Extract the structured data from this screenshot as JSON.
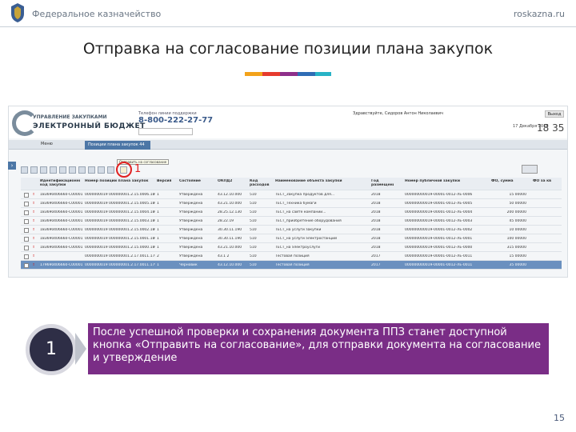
{
  "header": {
    "org": "Федеральное казначейство",
    "site": "roskazna.ru"
  },
  "slide": {
    "title": "Отправка на согласование позиции плана закупок",
    "page_number": "15"
  },
  "colors": {
    "bar": [
      "#f3a21a",
      "#e63b2e",
      "#8e2f8a",
      "#2f6db5",
      "#28b3c6"
    ],
    "note_bg": "#7a2d86"
  },
  "screenshot": {
    "logo_line1": "УПРАВЛЕНИЕ ЗАКУПКАМИ",
    "logo_line2": "ЭЛЕКТРОННЫЙ БЮДЖЕТ",
    "phone_label": "Телефон линии поддержки",
    "phone": "8-800-222-27-77",
    "user": "Здравствуйте, Сидоров Антон Николаевич",
    "exit": "Выход",
    "date": "17 Декабря 2018",
    "time": "18 35",
    "menu_tab": "Меню",
    "active_tab": "Позиции плана закупок 44",
    "tooltip": "Отправить на согласование",
    "marker_label": "1",
    "columns": [
      "Идентификационный код закупки",
      "Номер позиции плана закупок",
      "Версия",
      "Состояние",
      "ОКПД2",
      "Код расходов",
      "Наименование объекта закупки",
      "Год размещения",
      "Номер публичной закупки",
      "ФО, сумма",
      "ФО за кв"
    ],
    "rows": [
      [
        "183690406660-C00001...",
        "0000000019 000000001.2.15.0006.180",
        "1",
        "Утверждена",
        "43.12.10.000",
        "510",
        "ТЕСТ_Закупка продуктов для...",
        "2018",
        "000000000019-00001-0012-ЛЕ-0006",
        "15 00000"
      ],
      [
        "183690406660-C00001...",
        "0000000019 000000001.2.15.0005.180",
        "1",
        "Утверждена",
        "43.21.10.000",
        "510",
        "ТЕСТ_Техника бумаги",
        "2018",
        "000000000019-00001-0012-ЛЕ-0005",
        "50 00000"
      ],
      [
        "183690406660-C00001...",
        "0000000019 000000001.2.15.0004.180",
        "1",
        "Утверждена",
        "28.25.12.130",
        "510",
        "ТЕСТ_на сайте компании...",
        "2018",
        "000000000019-00001-0012-ЛЕ-0004",
        "200 00000"
      ],
      [
        "183690406660-C00001...",
        "0000000019 000000001.2.15.0003.180",
        "1",
        "Утверждена",
        "28.22.19",
        "510",
        "ТЕСТ_приобретение оборудования",
        "2018",
        "000000000019-00001-0012-ЛЕ-0003",
        "45 00000"
      ],
      [
        "183690406660-C00001...",
        "0000000019 000000001.2.15.0002.180",
        "1",
        "Утверждена",
        "30.30.11.190",
        "510",
        "ТЕСТ_на услуги закупки",
        "2018",
        "000000000019-00001-0012-ЛЕ-0002",
        "10 00000"
      ],
      [
        "183690406660-C00001...",
        "0000000019 000000001.2.15.0001.180",
        "1",
        "Утверждена",
        "30.30.11.190",
        "510",
        "ТЕСТ_на услуги электростанций",
        "2018",
        "000000000019-00001-0012-ЛЕ-0001",
        "100 00000"
      ],
      [
        "183690406660-C00001...",
        "0000000019 000000001.2.15.0000.180",
        "1",
        "Утверждена",
        "43.21.10.000",
        "510",
        "ТЕСТ_на электроуслуги",
        "2018",
        "000000000019-00001-0012-ЛЕ-0000",
        "315 00000"
      ],
      [
        "",
        "0000000019 000000001.2.17.0011.178",
        "2",
        "Утверждена",
        "43.1 2",
        "510",
        "Тестовая позиция",
        "2017",
        "000000000019-00001-0012-ЛЕ-0011",
        "15 00000"
      ],
      [
        "179690406660-C00001...",
        "0000000019 000000001.2.17.0011.179",
        "1",
        "Черновик",
        "43.12.10.000",
        "510",
        "Тестовая позиция",
        "2017",
        "000000000019-00001-0012-ЛЕ-0011",
        "35 00000"
      ]
    ]
  },
  "callout": {
    "number": "1",
    "text": "После успешной проверки и сохранения документа ППЗ станет доступной кнопка «Отправить на согласование», для отправки документа на согласование и утверждение"
  }
}
